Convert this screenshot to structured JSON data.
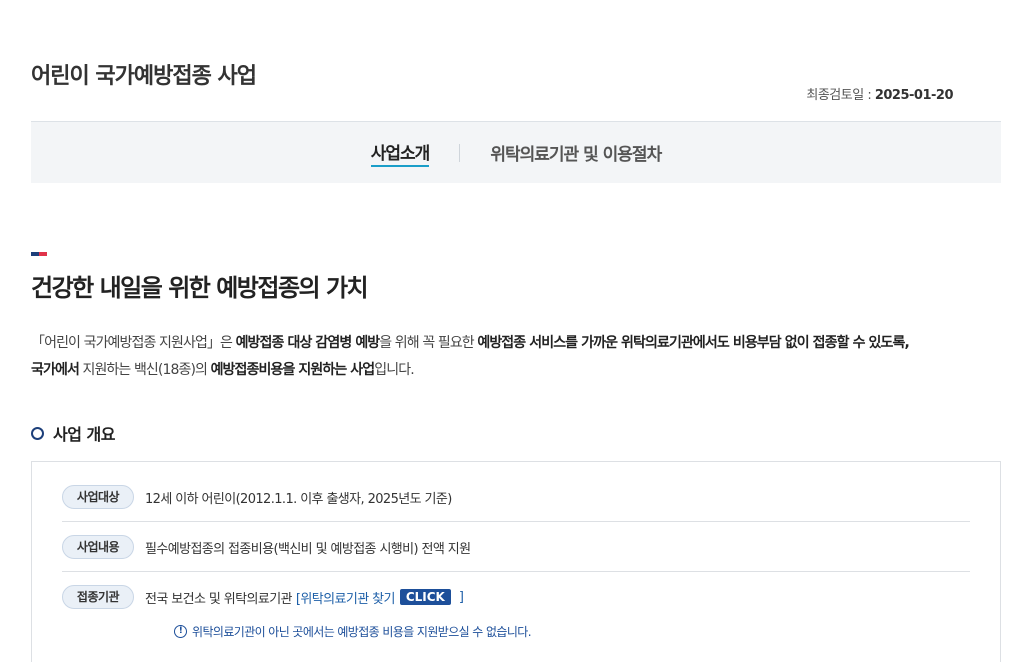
{
  "header": {
    "title": "어린이 국가예방접종 사업",
    "last_review_label": "최종검토일 : ",
    "last_review_date": "2025-01-20"
  },
  "tabs": [
    {
      "label": "사업소개",
      "active": true
    },
    {
      "label": "위탁의료기관 및 이용절차",
      "active": false
    }
  ],
  "section": {
    "heading": "건강한 내일을 위한 예방접종의 가치",
    "intro": {
      "p1": "「어린이 국가예방접종 지원사업」은 ",
      "b1": "예방접종 대상 감염병 예방",
      "p2": "을 위해 꼭 필요한 ",
      "b2": "예방접종 서비스를 가까운 위탁의료기관에서도 비용부담 없이 접종할 수 있도록,",
      "b3": "국가에서",
      "p3": " 지원하는 백신(18종)의 ",
      "b4": "예방접종비용을 지원하는 사업",
      "p4": "입니다."
    }
  },
  "overview": {
    "heading": "사업 개요",
    "rows": [
      {
        "badge": "사업대상",
        "text": "12세 이하 어린이(2012.1.1. 이후 출생자, 2025년도 기준)"
      },
      {
        "badge": "사업내용",
        "text": "필수예방접종의 접종비용(백신비 및 예방접종 시행비) 전액 지원"
      },
      {
        "badge": "접종기관",
        "text": "전국 보건소 및 위탁의료기관",
        "link_text": "[위탁의료기관 찾기",
        "button": "CLICK",
        "bracket": "]"
      }
    ],
    "notice": "위탁의료기관이 아닌 곳에서는 예방접종 비용을 지원받으실 수 없습니다."
  },
  "colors": {
    "accent_navy": "#1d3f7a",
    "accent_red": "#e0334a",
    "tab_underline": "#1a9ec9",
    "link_blue": "#1d5fa8"
  }
}
